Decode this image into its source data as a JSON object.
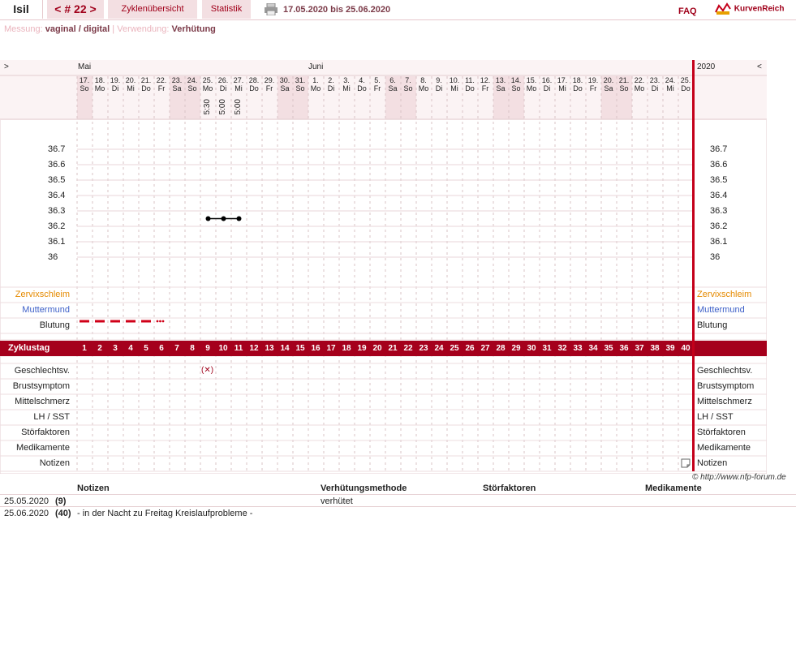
{
  "header": {
    "user": "Isil",
    "cycle": "< # 22 >",
    "tab_overview": "Zyklenübersicht",
    "tab_stats": "Statistik",
    "date_range": "17.05.2020 bis 25.06.2020",
    "faq": "FAQ",
    "brand": "KurvenReich"
  },
  "measurement": {
    "label_messung": "Messung:",
    "value_messung": "vaginal / digital",
    "sep": "|",
    "label_verwendung": "Verwendung:",
    "value_verwendung": "Verhütung"
  },
  "chart": {
    "nav_left": ">",
    "nav_right": "<",
    "month_mai": "Mai",
    "month_juni": "Juni",
    "year": "2020",
    "days": [
      {
        "d": "17.",
        "w": "So",
        "we": true
      },
      {
        "d": "18.",
        "w": "Mo"
      },
      {
        "d": "19.",
        "w": "Di"
      },
      {
        "d": "20.",
        "w": "Mi"
      },
      {
        "d": "21.",
        "w": "Do"
      },
      {
        "d": "22.",
        "w": "Fr"
      },
      {
        "d": "23.",
        "w": "Sa",
        "we": true
      },
      {
        "d": "24.",
        "w": "So",
        "we": true
      },
      {
        "d": "25.",
        "w": "Mo",
        "t": "5:30"
      },
      {
        "d": "26.",
        "w": "Di",
        "t": "5:00"
      },
      {
        "d": "27.",
        "w": "Mi",
        "t": "5:00"
      },
      {
        "d": "28.",
        "w": "Do"
      },
      {
        "d": "29.",
        "w": "Fr"
      },
      {
        "d": "30.",
        "w": "Sa",
        "we": true
      },
      {
        "d": "31.",
        "w": "So",
        "we": true
      },
      {
        "d": "1.",
        "w": "Mo"
      },
      {
        "d": "2.",
        "w": "Di"
      },
      {
        "d": "3.",
        "w": "Mi"
      },
      {
        "d": "4.",
        "w": "Do"
      },
      {
        "d": "5.",
        "w": "Fr"
      },
      {
        "d": "6.",
        "w": "Sa",
        "we": true
      },
      {
        "d": "7.",
        "w": "So",
        "we": true
      },
      {
        "d": "8.",
        "w": "Mo"
      },
      {
        "d": "9.",
        "w": "Di"
      },
      {
        "d": "10.",
        "w": "Mi"
      },
      {
        "d": "11.",
        "w": "Do"
      },
      {
        "d": "12.",
        "w": "Fr"
      },
      {
        "d": "13.",
        "w": "Sa",
        "we": true
      },
      {
        "d": "14.",
        "w": "So",
        "we": true
      },
      {
        "d": "15.",
        "w": "Mo"
      },
      {
        "d": "16.",
        "w": "Di"
      },
      {
        "d": "17.",
        "w": "Mi"
      },
      {
        "d": "18.",
        "w": "Do"
      },
      {
        "d": "19.",
        "w": "Fr"
      },
      {
        "d": "20.",
        "w": "Sa",
        "we": true
      },
      {
        "d": "21.",
        "w": "So",
        "we": true
      },
      {
        "d": "22.",
        "w": "Mo"
      },
      {
        "d": "23.",
        "w": "Di"
      },
      {
        "d": "24.",
        "w": "Mi"
      },
      {
        "d": "25.",
        "w": "Do"
      }
    ],
    "temps_left": [
      "36.7",
      "36.6",
      "36.5",
      "36.4",
      "36.3",
      "36.2",
      "36.1",
      "36"
    ],
    "temps_right": [
      "36.7",
      "36.6",
      "36.5",
      "36.4",
      "36.3",
      "36.2",
      "36.1",
      "36"
    ],
    "row_zervix": "Zervixschleim",
    "row_muttermund": "Muttermund",
    "row_blutung": "Blutung",
    "row_zyklustag": "Zyklustag",
    "rows_lower": [
      "Geschlechtsv.",
      "Brustsymptom",
      "Mittelschmerz",
      "LH / SST",
      "Störfaktoren",
      "Medikamente",
      "Notizen"
    ],
    "intercourse_mark": "(✕)",
    "copyright": "© http://www.nfp-forum.de"
  },
  "chart_data": {
    "type": "line",
    "x": [
      "25.",
      "26.",
      "27."
    ],
    "values": [
      36.25,
      36.25,
      36.25
    ],
    "ylim": [
      36.0,
      36.7
    ]
  },
  "notes_table": {
    "headers": [
      "Notizen",
      "Verhütungsmethode",
      "Störfaktoren",
      "Medikamente"
    ],
    "rows": [
      {
        "date": "25.05.2020",
        "day": "(9)",
        "note": "",
        "method": "verhütet"
      },
      {
        "date": "25.06.2020",
        "day": "(40)",
        "note": "- in der Nacht zu Freitag Kreislaufprobleme -",
        "method": ""
      }
    ]
  },
  "colors": {
    "accent": "#a5001c",
    "weekend": "#f6e6e8",
    "grid": "#e8d6d9"
  }
}
